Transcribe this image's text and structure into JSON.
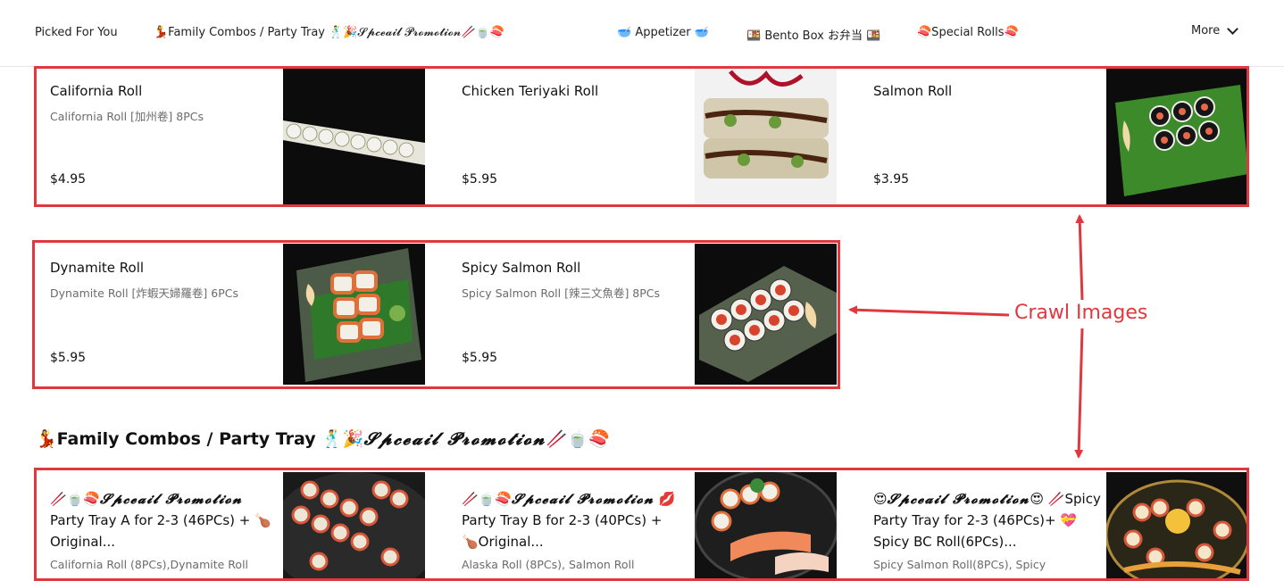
{
  "nav": {
    "items": [
      "Picked For You",
      "💃Family Combos / Party Tray 🕺🎉𝓢𝓹𝓬𝓮𝓪𝓲𝓵 𝓟𝓻𝓸𝓶𝓸𝓽𝓲𝓸𝓷🥢🍵🍣",
      "🥣 Appetizer 🥣",
      "🍱 Bento Box お弁当 🍱",
      "🍣Special Rolls🍣"
    ],
    "more_label": "More"
  },
  "row1": [
    {
      "name": "California Roll",
      "desc": "California Roll [加州卷] 8PCs",
      "price": "$4.95"
    },
    {
      "name": "Chicken Teriyaki Roll",
      "desc": "",
      "price": "$5.95"
    },
    {
      "name": "Salmon Roll",
      "desc": "",
      "price": "$3.95"
    }
  ],
  "row2": [
    {
      "name": "Dynamite Roll",
      "desc": "Dynamite Roll [炸蝦天婦羅卷] 6PCs",
      "price": "$5.95"
    },
    {
      "name": "Spicy Salmon Roll",
      "desc": "Spicy Salmon Roll [辣三文魚卷] 8PCs",
      "price": "$5.95"
    }
  ],
  "section": {
    "prefix": "💃Family Combos / Party Tray 🕺🎉",
    "script": "𝓢𝓹𝓬𝓮𝓪𝓲𝓵 𝓟𝓻𝓸𝓶𝓸𝓽𝓲𝓸𝓷",
    "suffix": "🥢🍵🍣"
  },
  "promo": [
    {
      "pre": "🥢🍵🍣",
      "script": "𝓢𝓹𝓬𝓮𝓪𝓲𝓵 𝓟𝓻𝓸𝓶𝓸𝓽𝓲𝓸𝓷",
      "rest": " Party Tray A for 2-3 (46PCs) + 🍗Original...",
      "desc": "California Roll (8PCs),Dynamite Roll"
    },
    {
      "pre": "🥢🍵🍣",
      "script": "𝓢𝓹𝓬𝓮𝓪𝓲𝓵 𝓟𝓻𝓸𝓶𝓸𝓽𝓲𝓸𝓷",
      "rest": " 💋Party Tray B for 2-3 (40PCs) + 🍗Original...",
      "desc": "Alaska Roll (8PCs), Salmon Roll"
    },
    {
      "pre": "😍",
      "script": "𝓢𝓹𝓬𝓮𝓪𝓲𝓵 𝓟𝓻𝓸𝓶𝓸𝓽𝓲𝓸𝓷",
      "rest": "😍 🥢Spicy Party Tray for 2-3 (46PCs)+ 💝Spicy BC Roll(6PCs)...",
      "desc": "Spicy Salmon Roll(8PCs), Spicy"
    }
  ],
  "annotation": "Crawl Images",
  "colors": {
    "annotation_red": "#e0383f"
  }
}
